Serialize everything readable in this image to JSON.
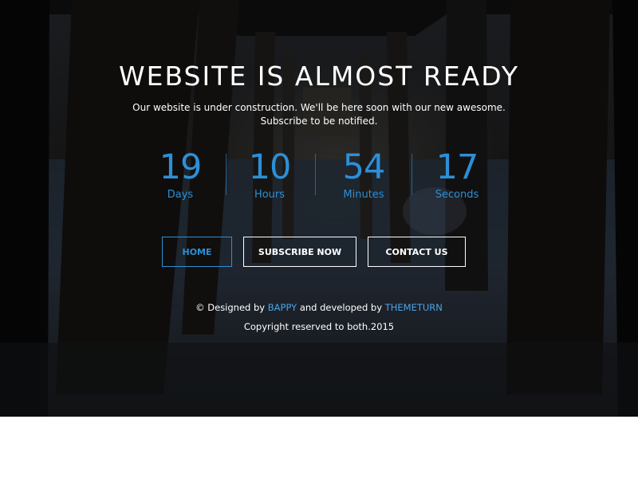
{
  "page": {
    "title": "WEBSITE IS ALMOST READY",
    "subtitle_line1": "Our website is under construction. We'll be here soon with our new awesome.",
    "subtitle_line2": "Subscribe to be notified."
  },
  "countdown": [
    {
      "value": "19",
      "label": "Days"
    },
    {
      "value": "10",
      "label": "Hours"
    },
    {
      "value": "54",
      "label": "Minutes"
    },
    {
      "value": "17",
      "label": "Seconds"
    }
  ],
  "nav": {
    "home_label": "HOME",
    "subscribe_label": "SUBSCRIBE NOW",
    "contact_label": "CONTACT US"
  },
  "footer": {
    "prefix": "© Designed by",
    "designer": "BAPPY",
    "middle": "and developed by",
    "developer": "THEMETURN",
    "copyright": "Copyright reserved to both.2015"
  },
  "colors": {
    "accent": "#2d8fd6",
    "link": "#4aa3e8",
    "text": "#ffffff",
    "overlay": "#141619"
  }
}
